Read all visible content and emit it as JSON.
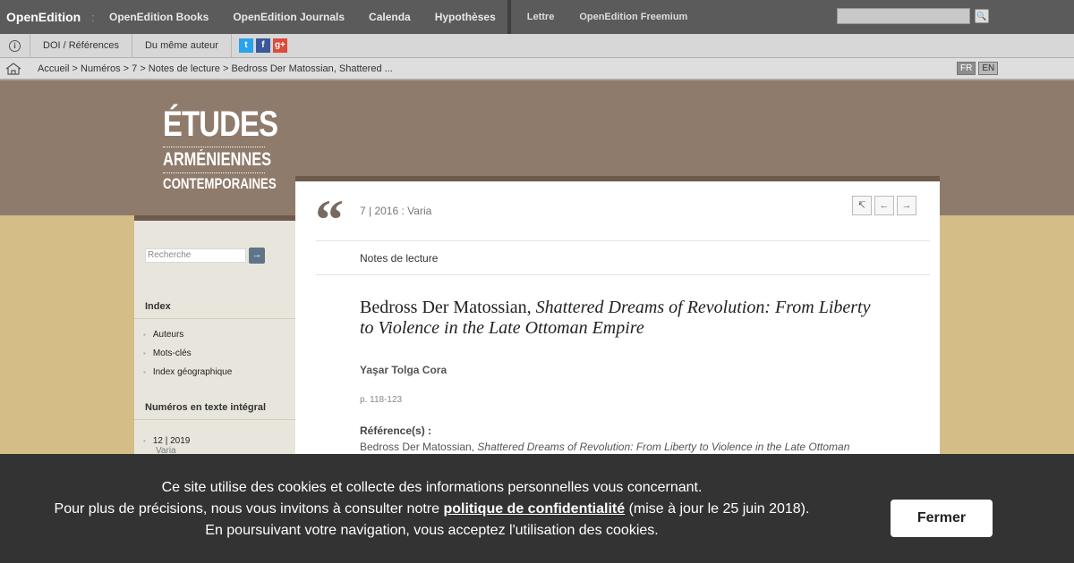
{
  "topbar": {
    "brand": "OpenEdition",
    "separator": ":",
    "nav": [
      "OpenEdition Books",
      "OpenEdition Journals",
      "Calenda",
      "Hypothèses"
    ],
    "nav2": [
      "Lettre",
      "OpenEdition Freemium"
    ],
    "search_button": "🔍"
  },
  "toolbar": {
    "info": "i",
    "doi": "DOI / Références",
    "same_author": "Du même auteur",
    "social": {
      "twitter": "t",
      "facebook": "f",
      "google": "g+"
    }
  },
  "breadcrumb": {
    "text": "Accueil > Numéros > 7 > Notes de lecture > Bedross Der Matossian, Shattered ...",
    "lang_fr": "FR",
    "lang_en": "EN"
  },
  "logo": {
    "line1": "ÉTUDES",
    "line2": "ARMÉNIENNES",
    "line3": "CONTEMPORAINES"
  },
  "sidebar": {
    "search_placeholder": "Recherche",
    "search_button": "→",
    "index_heading": "Index",
    "index_items": [
      "Auteurs",
      "Mots-clés",
      "Index géographique"
    ],
    "issues_heading": "Numéros en texte intégral",
    "issue_number": "12 | 2019",
    "issue_sub": "Varia"
  },
  "article": {
    "quote_mark": "“",
    "issue_label": "7 | 2016 : Varia",
    "nav_buttons": [
      "↸",
      "←",
      "→"
    ],
    "section": "Notes de lecture",
    "title_plain": "Bedross Der Matossian, ",
    "title_italic": "Shattered Dreams of Revolution: From Liberty to Violence in the Late Ottoman Empire",
    "author": "Yaşar Tolga Cora",
    "pages": "p. 118-123",
    "ref_label": "Référence(s) :",
    "ref_plain": "Bedross Der Matossian, ",
    "ref_italic": "Shattered Dreams of Revolution: From Liberty to Violence in the Late Ottoman"
  },
  "cookie": {
    "line1": "Ce site utilise des cookies et collecte des informations personnelles vous concernant.",
    "line2_pre": "Pour plus de précisions, nous vous invitons à consulter notre ",
    "line2_link": "politique de confidentialité",
    "line2_post": " (mise à jour le 25 juin 2018).",
    "line3": "En poursuivant votre navigation, vous acceptez l'utilisation des cookies.",
    "button": "Fermer"
  }
}
